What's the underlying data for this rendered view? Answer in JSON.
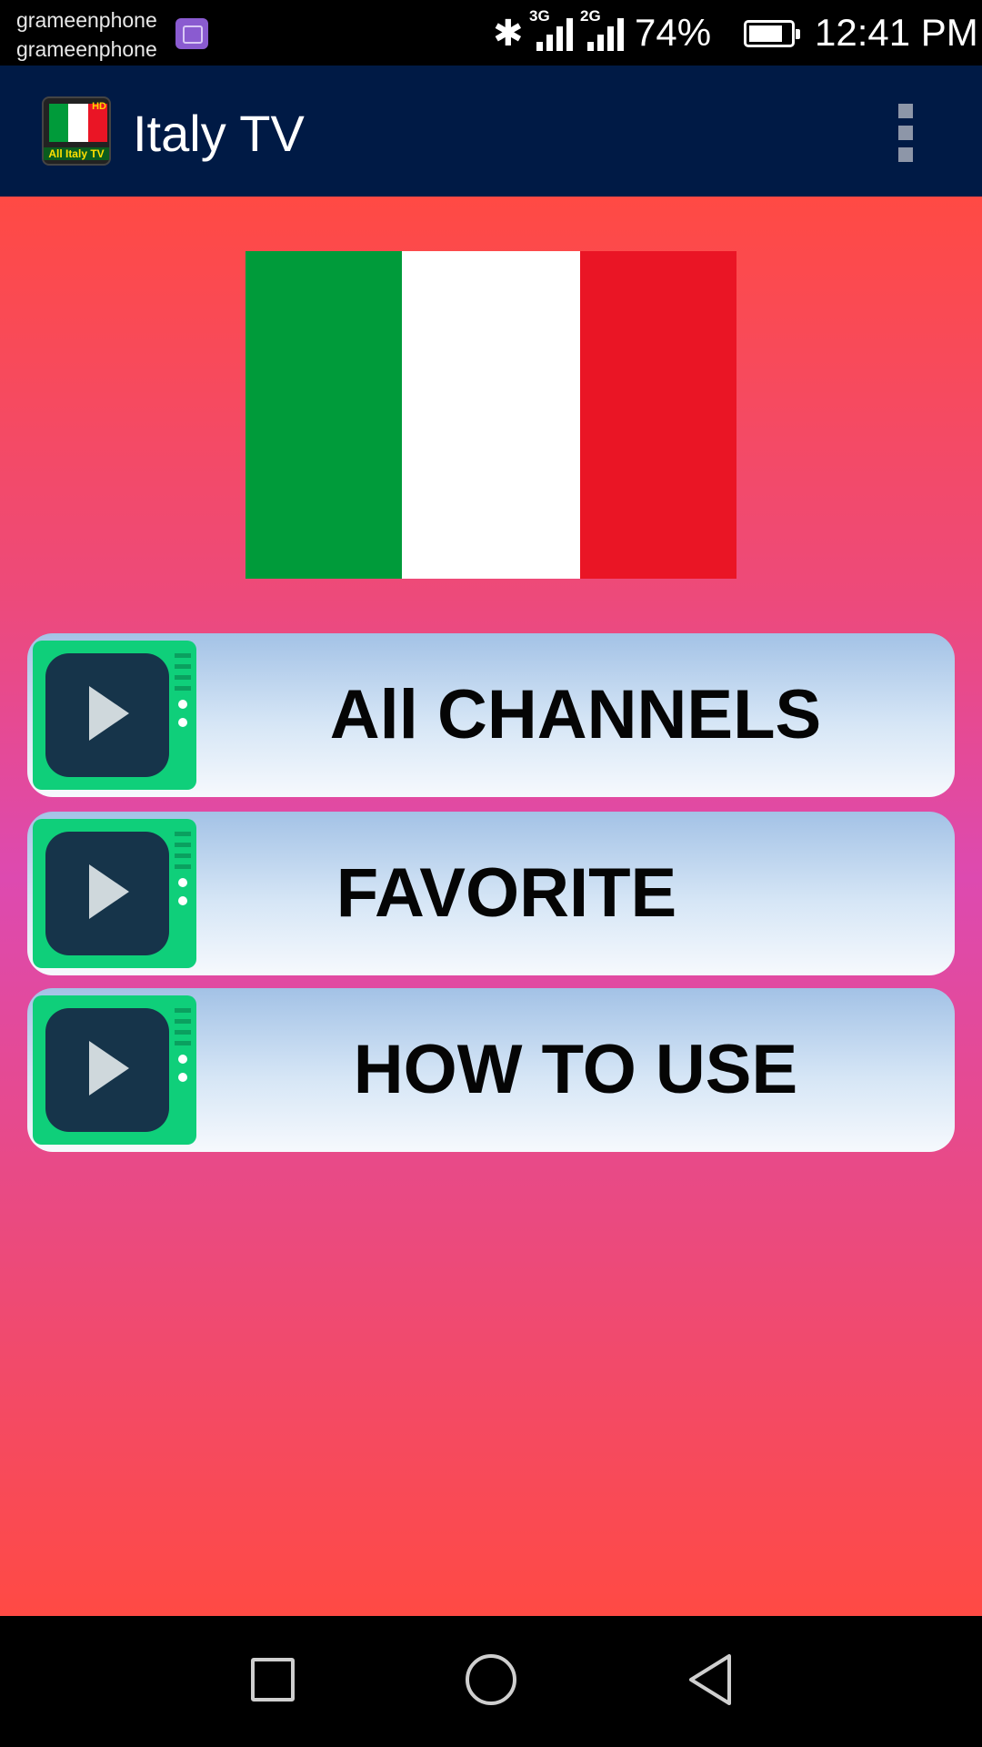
{
  "status_bar": {
    "carrier_1": "grameenphone",
    "carrier_2": "grameenphone",
    "network_1": "3G",
    "network_2": "2G",
    "battery_percent": "74%",
    "time": "12:41 PM"
  },
  "app_bar": {
    "title": "Italy TV",
    "logo_badge": "HD",
    "logo_text": "All Italy TV"
  },
  "flag": {
    "colors": [
      "#009b3a",
      "#ffffff",
      "#ea1525"
    ]
  },
  "menu": {
    "items": [
      {
        "label": "All CHANNELS",
        "icon": "tv-play-icon"
      },
      {
        "label": "FAVORITE",
        "icon": "tv-play-icon"
      },
      {
        "label": "HOW TO USE",
        "icon": "tv-play-icon"
      }
    ]
  },
  "nav_bar": {
    "icons": [
      "recent-apps-icon",
      "home-icon",
      "back-icon"
    ]
  }
}
